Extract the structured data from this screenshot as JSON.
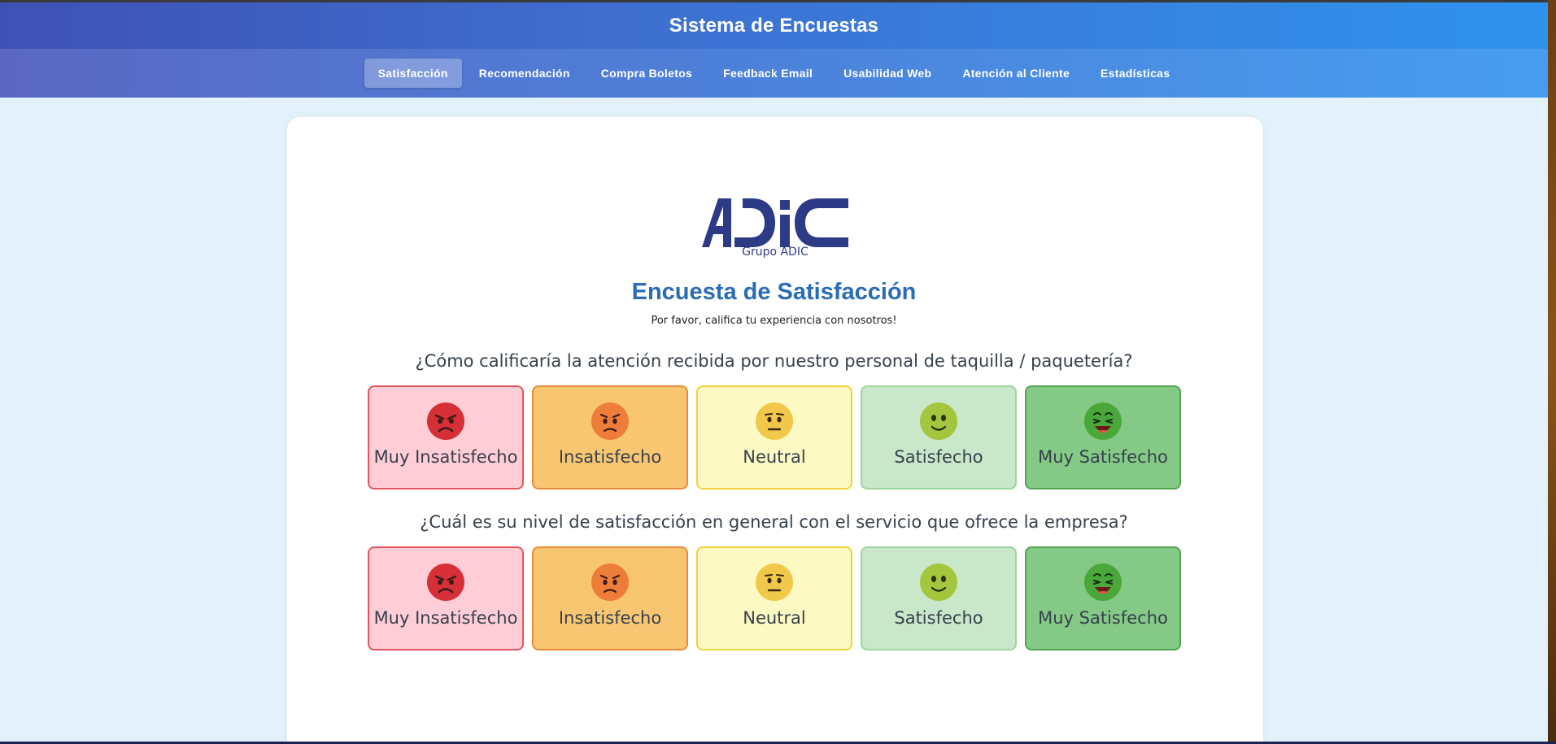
{
  "header": {
    "title": "Sistema de Encuestas"
  },
  "nav": {
    "tabs": [
      {
        "label": "Satisfacción",
        "active": true
      },
      {
        "label": "Recomendación",
        "active": false
      },
      {
        "label": "Compra Boletos",
        "active": false
      },
      {
        "label": "Feedback Email",
        "active": false
      },
      {
        "label": "Usabilidad Web",
        "active": false
      },
      {
        "label": "Atención al Cliente",
        "active": false
      },
      {
        "label": "Estadísticas",
        "active": false
      }
    ]
  },
  "logo": {
    "text": "ADIC",
    "subtitle": "Grupo ADIC",
    "color": "#2d3b86"
  },
  "survey": {
    "title": "Encuesta de Satisfacción",
    "subtitle": "Por favor, califica tu experiencia con nosotros!",
    "questions": [
      {
        "text": "¿Cómo calificaría la atención recibida por nuestro personal de taquilla / paquetería?",
        "options": [
          {
            "label": "Muy Insatisfecho",
            "icon": "very-angry-face-icon",
            "color": "#d62f38"
          },
          {
            "label": "Insatisfecho",
            "icon": "angry-face-icon",
            "color": "#ee7d3a"
          },
          {
            "label": "Neutral",
            "icon": "neutral-face-icon",
            "color": "#f2c84b"
          },
          {
            "label": "Satisfecho",
            "icon": "smiling-face-icon",
            "color": "#a4c63e"
          },
          {
            "label": "Muy Satisfecho",
            "icon": "laughing-face-icon",
            "color": "#4aa83a"
          }
        ]
      },
      {
        "text": "¿Cuál es su nivel de satisfacción en general con el servicio que ofrece la empresa?",
        "options": [
          {
            "label": "Muy Insatisfecho",
            "icon": "very-angry-face-icon",
            "color": "#d62f38"
          },
          {
            "label": "Insatisfecho",
            "icon": "angry-face-icon",
            "color": "#ee7d3a"
          },
          {
            "label": "Neutral",
            "icon": "neutral-face-icon",
            "color": "#f2c84b"
          },
          {
            "label": "Satisfecho",
            "icon": "smiling-face-icon",
            "color": "#a4c63e"
          },
          {
            "label": "Muy Satisfecho",
            "icon": "laughing-face-icon",
            "color": "#4aa83a"
          }
        ]
      }
    ]
  }
}
